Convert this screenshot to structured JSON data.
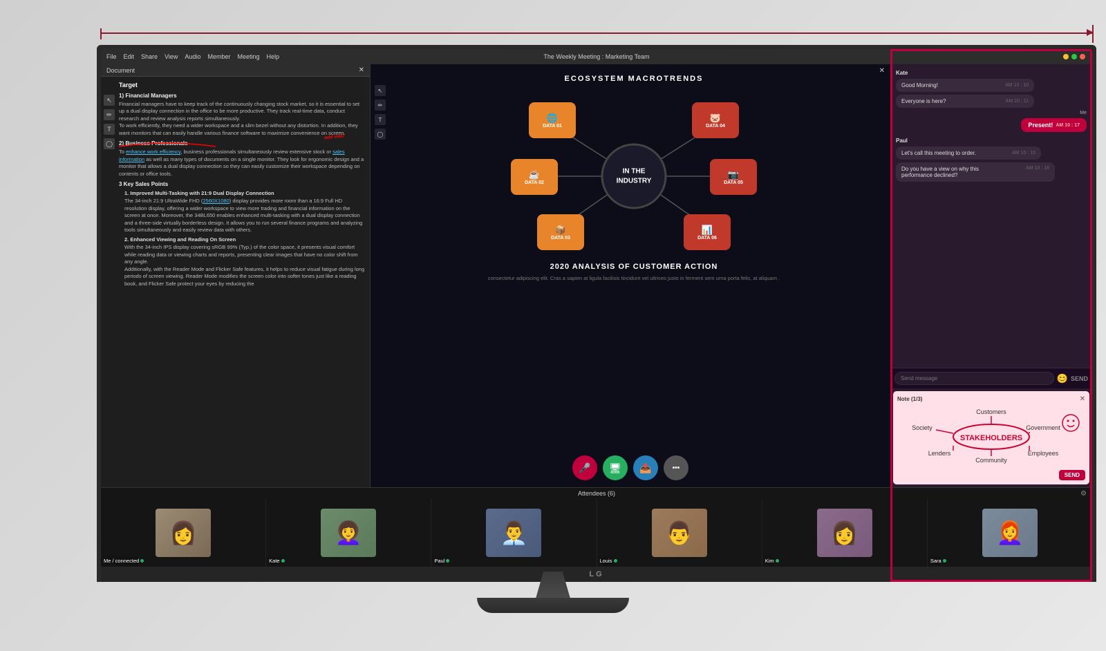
{
  "measurement": {
    "arrow_color": "#8b1a2e"
  },
  "monitor": {
    "title": "The Weekly Meeting : Marketing Team",
    "menu_items": [
      "File",
      "Edit",
      "Share",
      "View",
      "Audio",
      "Member",
      "Meeting",
      "Help"
    ],
    "dot_colors": [
      "#ff5f57",
      "#febc2e",
      "#28c840"
    ]
  },
  "document": {
    "title": "Target",
    "sections": [
      {
        "heading": "1) Financial Managers",
        "text": "Financial managers have to keep track of the continuously changing stock market, so it is essential to set up a dual display connection in the office to be more productive. They track real-time data, conduct research and review analysis reports simultaneously. To work efficiently, they need a wider workspace and a slim bezel without any distraction. In addition, they want monitors that can easily handle various finance software to maximize convenience on screen."
      },
      {
        "heading": "2) Business Professionals",
        "text": "To enhance work efficiency, business professionals simultaneously review extensive stock or sales information as well as many types of documents on a single monitor. They look for ergonomic design and a monitor that allows a dual display connection so they can easily customize their workspace depending on contents or office tools."
      },
      {
        "heading": "3 Key Sales Points",
        "sub_points": [
          {
            "title": "1. Improved Multi-Tasking with 21:9 Dual Display Connection",
            "text": "The 34-inch 21:9 UltraWide FHD (2560X1080) display provides more room than a 16:9 Full HD resolution display, offering a wider workspace to view more trading and financial information on the screen at once. Moreover, the 34BL650 enables enhanced multi-tasking with a dual display connection and a three-side virtually borderless design. It allows you to run several finance programs and analyzing tools simultaneously and easily review data with others."
          },
          {
            "title": "2. Enhanced Viewing and Reading On Screen",
            "text": "With the 34-inch IPS display covering sRGB 99% (Typ.) of the color space, it presents visual comfort while reading data or viewing charts and reports, presenting clear images that have no color shift from any angle. Additionally, with the Reader Mode and Flicker Safe features, it helps to reduce visual fatigue during long periods of screen viewing. Reader Mode modifies the screen color into softer tones just like a reading book, and Flicker Safe protect your eyes by reducing the"
          }
        ]
      }
    ]
  },
  "presentation": {
    "header": "ECOSYSTEM MACROTRENDS",
    "center_text": "IN THE\nINDUSTRY",
    "nodes": [
      {
        "id": "DATA 01",
        "icon": "🌐",
        "position": "top-left"
      },
      {
        "id": "DATA 02",
        "icon": "☕",
        "position": "mid-left"
      },
      {
        "id": "DATA 03",
        "icon": "📦",
        "position": "bot-left"
      },
      {
        "id": "DATA 04",
        "icon": "🐷",
        "position": "top-right"
      },
      {
        "id": "DATA 05",
        "icon": "📷",
        "position": "mid-right"
      },
      {
        "id": "DATA 06",
        "icon": "📊",
        "position": "bot-right"
      }
    ],
    "subtitle": "2020 ANALYSIS OF CUSTOMER ACTION",
    "lorem": "consectetur adipiscing elit. Cras a sapien at ligula facilisis tincidunt vel ultrices justo in ferment sem urna porta felis, at aliquam ."
  },
  "chat": {
    "sender_kate": "Kate",
    "sender_paul": "Paul",
    "sender_me": "Me",
    "messages": [
      {
        "sender": "Kate",
        "text": "Good Morning!",
        "time": "AM 10 : 10",
        "type": "other"
      },
      {
        "sender": "Kate",
        "text": "Everyone is here?",
        "time": "AM 10 : 11",
        "type": "other"
      },
      {
        "sender": "Me",
        "text": "Present!",
        "time": "AM 10 : 17",
        "type": "me-btn"
      },
      {
        "sender": "Paul",
        "text": "Let's call this meeting to order.",
        "time": "AM 10 : 15",
        "type": "other"
      },
      {
        "sender": "Paul",
        "text": "Do you have a view on why this performance declined?",
        "time": "AM 10 : 16",
        "type": "other"
      }
    ],
    "input_placeholder": "Send message",
    "send_label": "SEND",
    "note": {
      "title": "Note (1/3)",
      "content": "Stakeholders diagram",
      "send_label": "SEND"
    }
  },
  "attendees": {
    "title": "Attendees (6)",
    "people": [
      {
        "name": "Me / connected",
        "connected": true,
        "color": "#8B7355"
      },
      {
        "name": "Kate",
        "connected": true,
        "color": "#7B8B6F"
      },
      {
        "name": "Paul",
        "connected": true,
        "color": "#5B6B7B"
      },
      {
        "name": "Louis",
        "connected": true,
        "color": "#9B7B5B"
      },
      {
        "name": "Kim",
        "connected": true,
        "color": "#8B6B7B"
      },
      {
        "name": "Sara",
        "connected": true,
        "color": "#7B8B9B"
      }
    ]
  },
  "controls": {
    "mic_label": "🎤",
    "screen_label": "🖥",
    "share_label": "📤",
    "more_label": "•••"
  },
  "lg_brand": "LG"
}
